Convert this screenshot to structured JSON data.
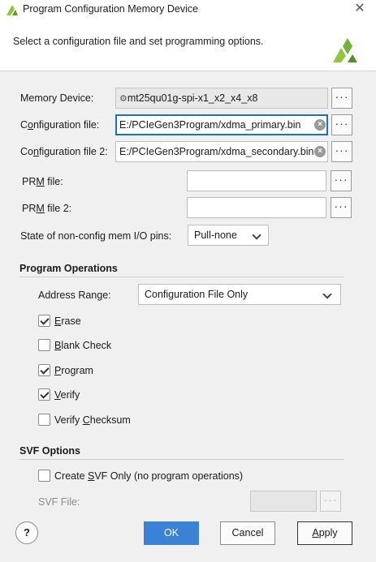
{
  "window": {
    "title": "Program Configuration Memory Device",
    "close_glyph": "✕"
  },
  "header": {
    "instruction": "Select a configuration file and set programming options."
  },
  "form": {
    "memory_device": {
      "label": "Memory Device:",
      "value": "mt25qu01g-spi-x1_x2_x4_x8"
    },
    "configuration_file": {
      "label_pre": "C",
      "label_u": "o",
      "label_post": "nfiguration file:",
      "value": "E:/PCIeGen3Program/xdma_primary.bin"
    },
    "configuration_file_2": {
      "label_pre": "Co",
      "label_u": "n",
      "label_post": "figuration file 2:",
      "value": "E:/PCIeGen3Program/xdma_secondary.bin"
    },
    "prm_file": {
      "label_pre": "PR",
      "label_u": "M",
      "label_post": " file:",
      "value": ""
    },
    "prm_file_2": {
      "label_pre": "PR",
      "label_u": "M",
      "label_post": " file 2:",
      "value": ""
    },
    "non_config_pins": {
      "label": "State of non-config mem I/O pins:",
      "value": "Pull-none"
    },
    "browse_label": "···"
  },
  "program_operations": {
    "title": "Program Operations",
    "address_range": {
      "label_pre": "Address Ran",
      "label_u": "g",
      "label_post": "e:",
      "value": "Configuration File Only"
    },
    "options": [
      {
        "pre": "",
        "u": "E",
        "post": "rase",
        "checked": true
      },
      {
        "pre": "",
        "u": "B",
        "post": "lank Check",
        "checked": false
      },
      {
        "pre": "",
        "u": "P",
        "post": "rogram",
        "checked": true
      },
      {
        "pre": "",
        "u": "V",
        "post": "erify",
        "checked": true
      },
      {
        "pre": "Verify ",
        "u": "C",
        "post": "hecksum",
        "checked": false
      }
    ]
  },
  "svf_options": {
    "title": "SVF Options",
    "create_svf": {
      "pre": "Create ",
      "u": "S",
      "post": "VF Only (no program operations)",
      "checked": false
    },
    "svf_file": {
      "label": "SVF File:",
      "value": ""
    }
  },
  "footer": {
    "help_label": "?",
    "ok_label": "OK",
    "cancel_label": "Cancel",
    "apply_pre": "",
    "apply_u": "A",
    "apply_post": "pply"
  },
  "colors": {
    "primary_button": "#3a82d6",
    "focus_border": "#1a6fc9",
    "brand_green": "#8dc63f"
  }
}
